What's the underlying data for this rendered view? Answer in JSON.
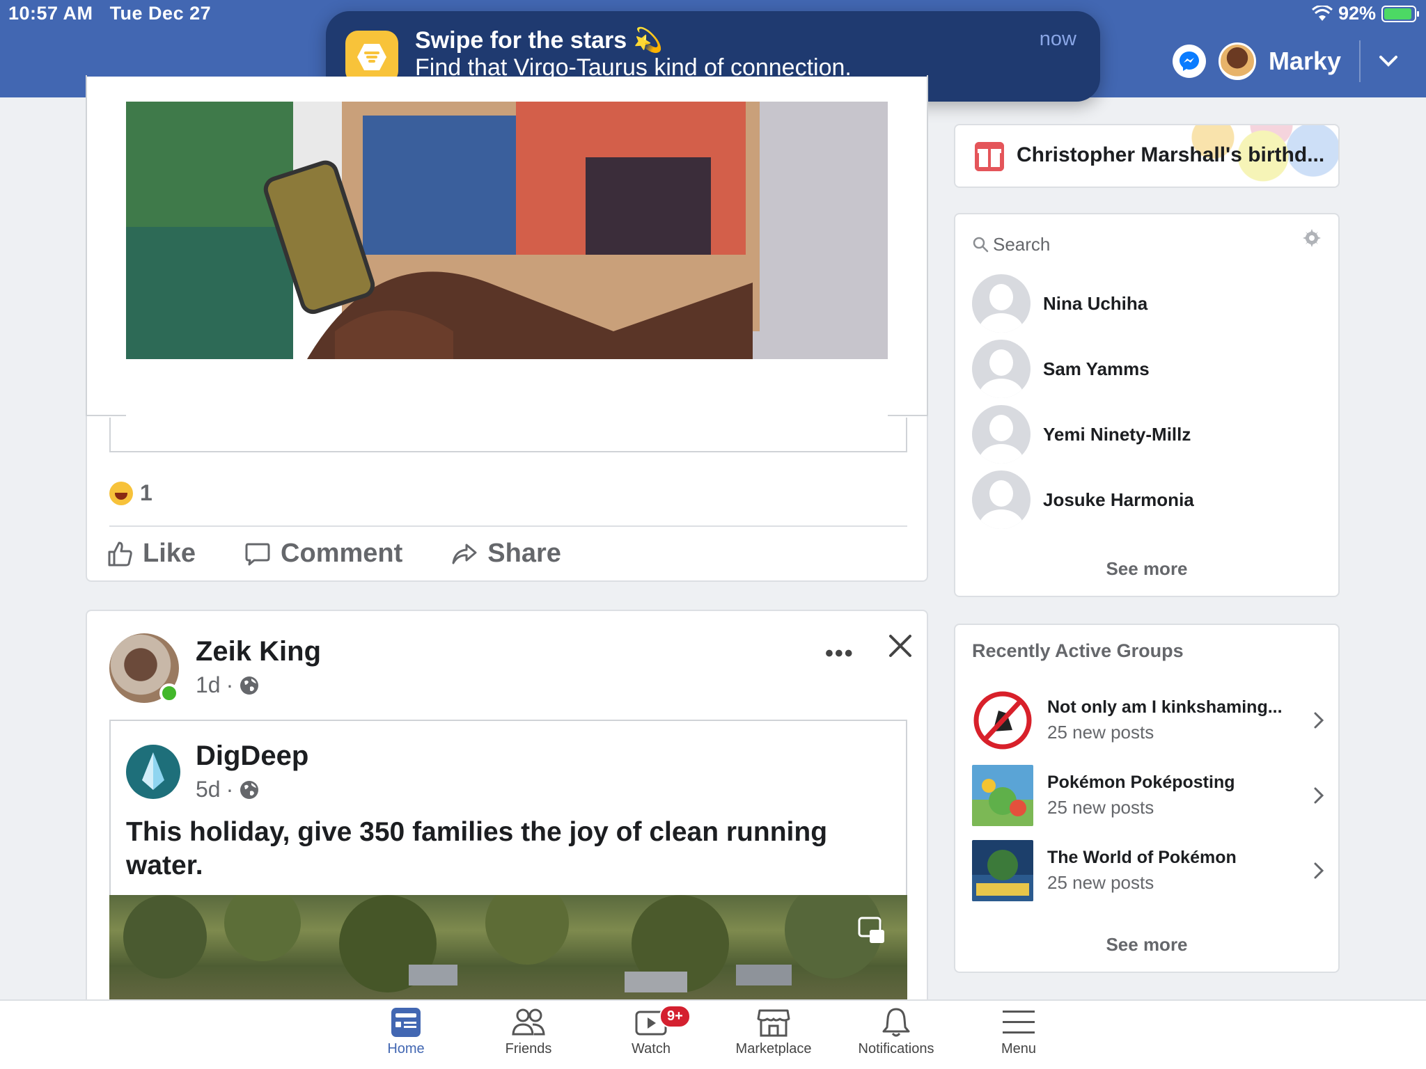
{
  "status_bar": {
    "time": "10:57 AM",
    "date": "Tue Dec 27",
    "battery": "92%",
    "battery_level": 0.92
  },
  "header": {
    "user_name": "Marky"
  },
  "notification": {
    "title": "Swipe for the stars 💫",
    "body": "Find that Virgo-Taurus kind of connection.",
    "time": "now"
  },
  "post1": {
    "reaction_count": "1",
    "actions": {
      "like": "Like",
      "comment": "Comment",
      "share": "Share"
    }
  },
  "post2": {
    "author": "Zeik King",
    "age": "1d",
    "dot": "·",
    "shared": {
      "author": "DigDeep",
      "age": "5d",
      "text": "This holiday, give 350 families the joy of clean running water."
    }
  },
  "birthday": {
    "text": "Christopher Marshall's birthd..."
  },
  "contacts": {
    "search_placeholder": "Search",
    "items": [
      {
        "name": "Nina Uchiha"
      },
      {
        "name": "Sam Yamms"
      },
      {
        "name": "Yemi Ninety-Millz"
      },
      {
        "name": "Josuke Harmonia"
      }
    ],
    "see_more": "See more"
  },
  "groups": {
    "title": "Recently Active Groups",
    "items": [
      {
        "name": "Not only am I kinkshaming...",
        "sub": "25 new posts"
      },
      {
        "name": "Pokémon Poképosting",
        "sub": "25 new posts"
      },
      {
        "name": "The World of Pokémon",
        "sub": "25 new posts"
      }
    ],
    "see_more": "See more"
  },
  "tabbar": {
    "home": "Home",
    "friends": "Friends",
    "watch": "Watch",
    "watch_badge": "9+",
    "marketplace": "Marketplace",
    "notifications": "Notifications",
    "menu": "Menu"
  },
  "colors": {
    "brand": "#4267b2",
    "banner": "#1f3a70",
    "badge": "#d4202f",
    "online": "#42b72a"
  }
}
